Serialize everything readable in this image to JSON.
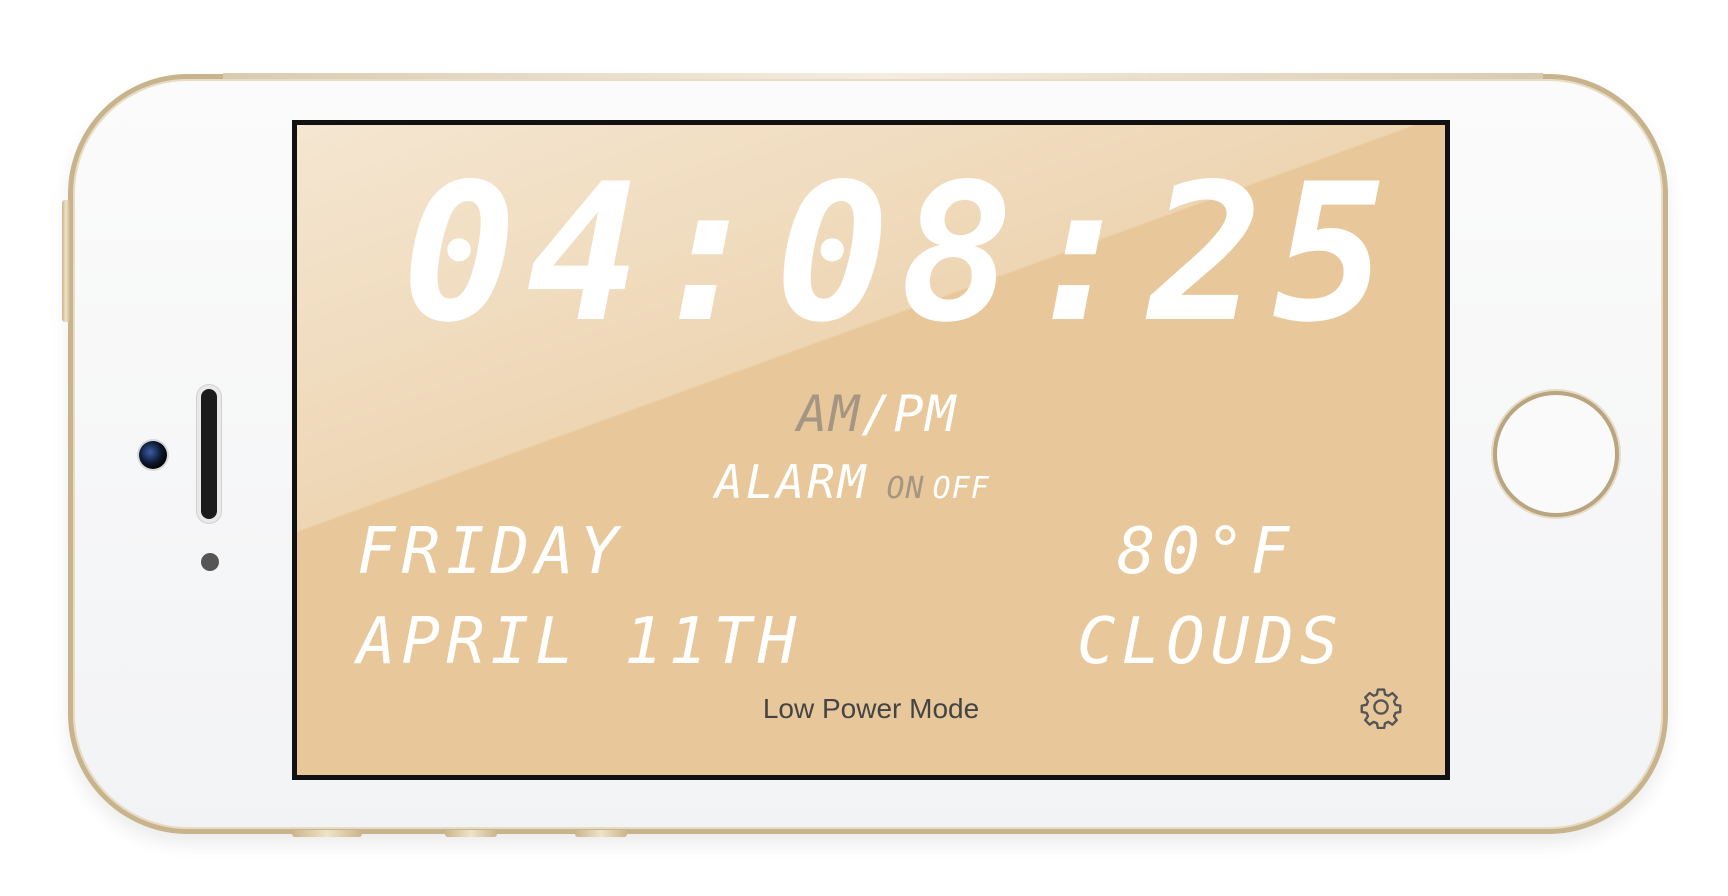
{
  "clock": {
    "time": "04:08:25",
    "am": "AM",
    "slash": "/",
    "pm": "PM",
    "alarm_label": "ALARM",
    "alarm_on": "ON",
    "alarm_off": "OFF",
    "day": "FRIDAY",
    "date": "APRIL 11TH",
    "temperature": "80°F",
    "condition": "CLOUDS",
    "footer": "Low Power Mode"
  },
  "icons": {
    "settings": "gear-icon"
  },
  "colors": {
    "screen_background": "#e8c89a",
    "digit": "#ffffff",
    "inactive_digit": "#a59684",
    "phone_gold": "#c8b48c"
  }
}
